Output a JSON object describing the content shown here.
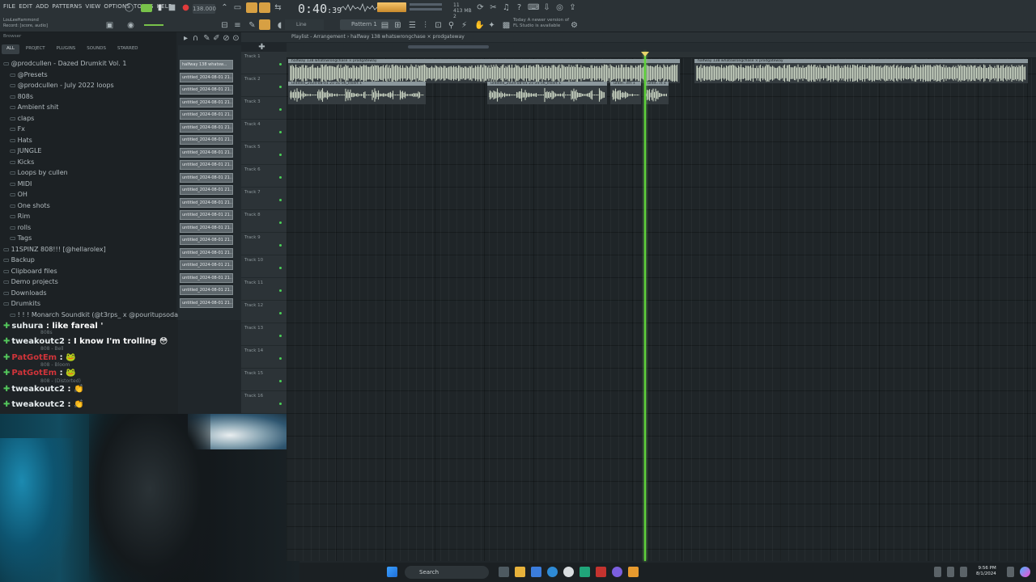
{
  "menu": [
    "FILE",
    "EDIT",
    "ADD",
    "PATTERNS",
    "VIEW",
    "OPTIONS",
    "TOOLS",
    "HELP"
  ],
  "transport": {
    "tempo": "138.000",
    "time_main": "0:40",
    "time_sub": ":39"
  },
  "record_info": {
    "line1": "LouLeeHammond",
    "line2": "Record: [score, audio]"
  },
  "cpu": {
    "line1": "11",
    "line2": "413 MB",
    "line3": "2"
  },
  "snap": "Line",
  "pattern": "Pattern 1",
  "news": {
    "line1": "Today  A newer version of",
    "line2": "FL Studio is available"
  },
  "browser": {
    "title": "Browser",
    "tabs": [
      "ALL",
      "PROJECT",
      "PLUGINS",
      "SOUNDS",
      "STARRED"
    ],
    "tree": [
      {
        "label": "@prodcullen - Dazed Drumkit Vol. 1",
        "depth": 0
      },
      {
        "label": "@Presets",
        "depth": 1
      },
      {
        "label": "@prodcullen - July 2022 loops",
        "depth": 1
      },
      {
        "label": "808s",
        "depth": 1
      },
      {
        "label": "Ambient shit",
        "depth": 1
      },
      {
        "label": "claps",
        "depth": 1
      },
      {
        "label": "Fx",
        "depth": 1
      },
      {
        "label": "Hats",
        "depth": 1
      },
      {
        "label": "JUNGLE",
        "depth": 1
      },
      {
        "label": "Kicks",
        "depth": 1
      },
      {
        "label": "Loops by cullen",
        "depth": 1
      },
      {
        "label": "MIDI",
        "depth": 1
      },
      {
        "label": "OH",
        "depth": 1
      },
      {
        "label": "One shots",
        "depth": 1
      },
      {
        "label": "Rim",
        "depth": 1
      },
      {
        "label": "rolls",
        "depth": 1
      },
      {
        "label": "Tags",
        "depth": 1
      },
      {
        "label": "11SPINZ 808!!! [@hellarolex]",
        "depth": 0
      },
      {
        "label": "Backup",
        "depth": 0
      },
      {
        "label": "Clipboard files",
        "depth": 0
      },
      {
        "label": "Demo projects",
        "depth": 0
      },
      {
        "label": "Downloads",
        "depth": 0
      },
      {
        "label": "Drumkits",
        "depth": 0
      },
      {
        "label": "! ! ! Monarch Soundkit (@t3rps_ x @pouritupsoda)",
        "depth": 1
      }
    ]
  },
  "chat": [
    {
      "user": "suhura",
      "msg": " : like fareal '",
      "color": "#e6ecee"
    },
    {
      "user": "tweakoutc2",
      "msg": " : I know I'm trolling 😳",
      "color": "#e6ecee"
    },
    {
      "user": "PatGotEm",
      "msg": " : 🐸",
      "color": "#d0343a"
    },
    {
      "user": "PatGotEm",
      "msg": " : 🐸",
      "color": "#d0343a"
    },
    {
      "user": "tweakoutc2",
      "msg": " : 👏",
      "color": "#e6ecee"
    },
    {
      "user": "tweakoutc2",
      "msg": " : 👏",
      "color": "#e6ecee"
    }
  ],
  "chat_ghost": [
    "808s",
    "808 - Bell",
    "808 - Bloom",
    "808 - (Distorted)"
  ],
  "patterns": [
    "halfway 138 whatsw...",
    "untitled_2024-08-01 21...",
    "untitled_2024-08-01 21...",
    "untitled_2024-08-01 21...",
    "untitled_2024-08-01 21...",
    "untitled_2024-08-01 21...",
    "untitled_2024-08-01 21...",
    "untitled_2024-08-01 21...",
    "untitled_2024-08-01 21...",
    "untitled_2024-08-01 21...",
    "untitled_2024-08-01 21...",
    "untitled_2024-08-01 21...",
    "untitled_2024-08-01 21...",
    "untitled_2024-08-01 21...",
    "untitled_2024-08-01 21...",
    "untitled_2024-08-01 21...",
    "untitled_2024-08-01 21...",
    "untitled_2024-08-01 21...",
    "untitled_2024-08-01 21...",
    "untitled_2024-08-01 21..."
  ],
  "playlist": {
    "breadcrumb": "Playlist - Arrangement  ›  halfway 138 whatswrongchase × prodgateway"
  },
  "tracks": [
    "Track 1",
    "Track 2",
    "Track 3",
    "Track 4",
    "Track 5",
    "Track 6",
    "Track 7",
    "Track 8",
    "Track 9",
    "Track 10",
    "Track 11",
    "Track 12",
    "Track 13",
    "Track 14",
    "Track 15",
    "Track 16"
  ],
  "clips": [
    {
      "title": "halfway 138 whatswrongchase × prodgateway",
      "track": 0
    },
    {
      "title": "halfway 138 whatswrongchase × prodgateway",
      "track": 0
    },
    {
      "title": "untitled_2024-08-01 21-31-56_Insert 1",
      "track": 1
    },
    {
      "title": "untitled_2024-08-01 21-34-56_Insert 1",
      "track": 1
    },
    {
      "title": "untitl...ert 1",
      "track": 1
    },
    {
      "title": "untit...rt 1",
      "track": 1
    }
  ],
  "taskbar": {
    "search": "Search",
    "time": "9:56 PM",
    "date": "8/1/2024"
  }
}
